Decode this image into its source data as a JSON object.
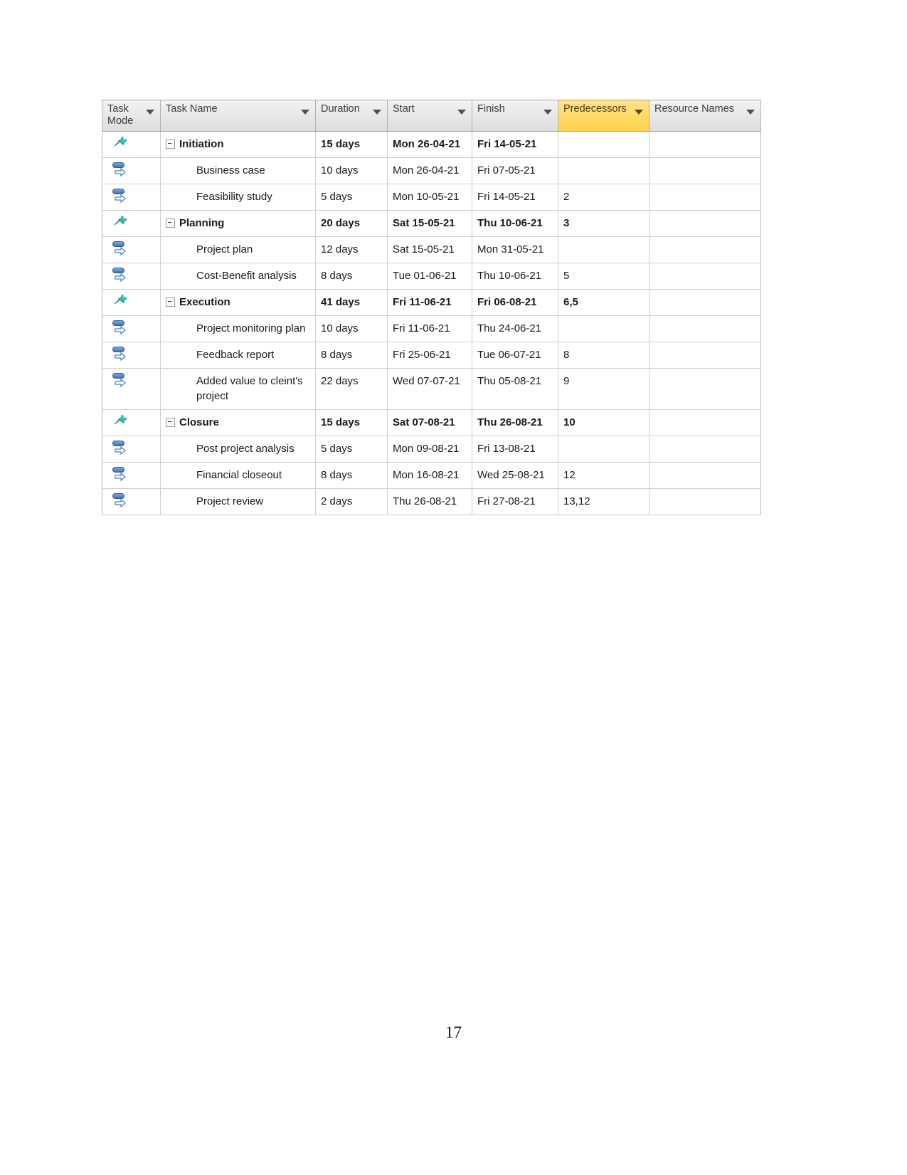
{
  "table": {
    "columns": [
      {
        "key": "mode",
        "label": "Task\nMode",
        "highlight": false
      },
      {
        "key": "name",
        "label": "Task Name",
        "highlight": false
      },
      {
        "key": "dur",
        "label": "Duration",
        "highlight": false
      },
      {
        "key": "start",
        "label": "Start",
        "highlight": false
      },
      {
        "key": "fin",
        "label": "Finish",
        "highlight": false
      },
      {
        "key": "pred",
        "label": "Predecessors",
        "highlight": true
      },
      {
        "key": "res",
        "label": "Resource Names",
        "highlight": false
      }
    ],
    "highlight_color": "#ffd95e",
    "rows": [
      {
        "mode_icon": "pushpin-icon",
        "name": "Initiation",
        "summary": true,
        "duration": "15 days",
        "start": "Mon 26-04-21",
        "finish": "Fri 14-05-21",
        "predecessors": "",
        "resources": ""
      },
      {
        "mode_icon": "auto-schedule-icon",
        "name": "Business case",
        "summary": false,
        "duration": "10 days",
        "start": "Mon 26-04-21",
        "finish": "Fri 07-05-21",
        "predecessors": "",
        "resources": ""
      },
      {
        "mode_icon": "auto-schedule-icon",
        "name": "Feasibility study",
        "summary": false,
        "duration": "5 days",
        "start": "Mon 10-05-21",
        "finish": "Fri 14-05-21",
        "predecessors": "2",
        "resources": ""
      },
      {
        "mode_icon": "pushpin-icon",
        "name": "Planning",
        "summary": true,
        "duration": "20 days",
        "start": "Sat 15-05-21",
        "finish": "Thu 10-06-21",
        "predecessors": "3",
        "resources": ""
      },
      {
        "mode_icon": "auto-schedule-icon",
        "name": "Project plan",
        "summary": false,
        "duration": "12 days",
        "start": "Sat 15-05-21",
        "finish": "Mon 31-05-21",
        "predecessors": "",
        "resources": ""
      },
      {
        "mode_icon": "auto-schedule-icon",
        "name": "Cost-Benefit analysis",
        "summary": false,
        "duration": "8 days",
        "start": "Tue 01-06-21",
        "finish": "Thu 10-06-21",
        "predecessors": "5",
        "resources": ""
      },
      {
        "mode_icon": "pushpin-icon",
        "name": "Execution",
        "summary": true,
        "duration": "41 days",
        "start": "Fri 11-06-21",
        "finish": "Fri 06-08-21",
        "predecessors": "6,5",
        "resources": ""
      },
      {
        "mode_icon": "auto-schedule-icon",
        "name": "Project monitoring plan",
        "summary": false,
        "duration": "10 days",
        "start": "Fri 11-06-21",
        "finish": "Thu 24-06-21",
        "predecessors": "",
        "resources": ""
      },
      {
        "mode_icon": "auto-schedule-icon",
        "name": "Feedback report",
        "summary": false,
        "duration": "8 days",
        "start": "Fri 25-06-21",
        "finish": "Tue 06-07-21",
        "predecessors": "8",
        "resources": ""
      },
      {
        "mode_icon": "auto-schedule-icon",
        "name": "Added value to cleint's project",
        "summary": false,
        "duration": "22 days",
        "start": "Wed 07-07-21",
        "finish": "Thu 05-08-21",
        "predecessors": "9",
        "resources": ""
      },
      {
        "mode_icon": "pushpin-icon",
        "name": "Closure",
        "summary": true,
        "duration": "15 days",
        "start": "Sat 07-08-21",
        "finish": "Thu 26-08-21",
        "predecessors": "10",
        "resources": ""
      },
      {
        "mode_icon": "auto-schedule-icon",
        "name": "Post project analysis",
        "summary": false,
        "duration": "5 days",
        "start": "Mon 09-08-21",
        "finish": "Fri 13-08-21",
        "predecessors": "",
        "resources": ""
      },
      {
        "mode_icon": "auto-schedule-icon",
        "name": "Financial closeout",
        "summary": false,
        "duration": "8 days",
        "start": "Mon 16-08-21",
        "finish": "Wed 25-08-21",
        "predecessors": "12",
        "resources": ""
      },
      {
        "mode_icon": "auto-schedule-icon",
        "name": "Project review",
        "summary": false,
        "duration": "2 days",
        "start": "Thu 26-08-21",
        "finish": "Fri 27-08-21",
        "predecessors": "13,12",
        "resources": ""
      }
    ]
  },
  "footer": {
    "page_number": "17"
  }
}
